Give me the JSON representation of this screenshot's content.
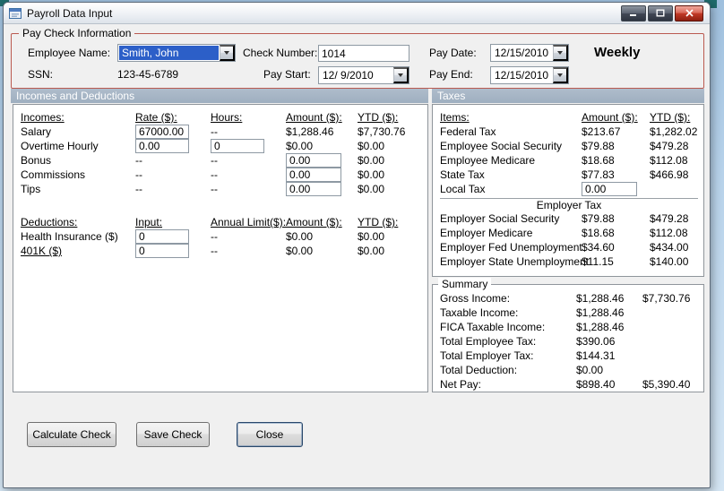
{
  "window": {
    "title": "Payroll Data Input"
  },
  "paycheck": {
    "group_title": "Pay Check Information",
    "employee_name": {
      "label": "Employee Name:",
      "value": "Smith, John"
    },
    "ssn": {
      "label": "SSN:",
      "value": "123-45-6789"
    },
    "check_number": {
      "label": "Check Number:",
      "value": "1014"
    },
    "pay_start": {
      "label": "Pay Start:",
      "value": "12/ 9/2010"
    },
    "pay_date": {
      "label": "Pay Date:",
      "value": "12/15/2010"
    },
    "pay_end": {
      "label": "Pay End:",
      "value": "12/15/2010"
    },
    "frequency": "Weekly"
  },
  "section_headers": {
    "left": "Incomes and Deductions",
    "right": "Taxes"
  },
  "incomes": {
    "headers": [
      "Incomes:",
      "Rate ($):",
      "Hours:",
      "Amount ($):",
      "YTD ($):"
    ],
    "rows": [
      {
        "label": "Salary",
        "rate": "67000.00",
        "hours": "--",
        "amount": "$1,288.46",
        "ytd": "$7,730.76"
      },
      {
        "label": "Overtime Hourly",
        "rate": "0.00",
        "hours": "0",
        "amount": "$0.00",
        "ytd": "$0.00"
      },
      {
        "label": "Bonus",
        "rate": "--",
        "hours": "--",
        "amount": "0.00",
        "ytd": "$0.00"
      },
      {
        "label": "Commissions",
        "rate": "--",
        "hours": "--",
        "amount": "0.00",
        "ytd": "$0.00"
      },
      {
        "label": "Tips",
        "rate": "--",
        "hours": "--",
        "amount": "0.00",
        "ytd": "$0.00"
      }
    ]
  },
  "deductions": {
    "headers": [
      "Deductions:",
      "Input:",
      "Annual Limit($):",
      "Amount ($):",
      "YTD ($):"
    ],
    "rows": [
      {
        "label": "Health Insurance  ($)",
        "input": "0",
        "limit": "--",
        "amount": "$0.00",
        "ytd": "$0.00"
      },
      {
        "label": "401K  ($)",
        "input": "0",
        "limit": "--",
        "amount": "$0.00",
        "ytd": "$0.00"
      }
    ]
  },
  "taxes": {
    "headers": [
      "Items:",
      "Amount ($):",
      "YTD ($):"
    ],
    "employee_rows": [
      {
        "label": "Federal Tax",
        "amount": "$213.67",
        "ytd": "$1,282.02"
      },
      {
        "label": "Employee Social Security",
        "amount": "$79.88",
        "ytd": "$479.28"
      },
      {
        "label": "Employee Medicare",
        "amount": "$18.68",
        "ytd": "$112.08"
      },
      {
        "label": "State Tax",
        "amount": "$77.83",
        "ytd": "$466.98"
      },
      {
        "label": "Local Tax",
        "amount": "0.00",
        "ytd": ""
      }
    ],
    "employer_divider": "Employer Tax",
    "employer_rows": [
      {
        "label": "Employer Social Security",
        "amount": "$79.88",
        "ytd": "$479.28"
      },
      {
        "label": "Employer Medicare",
        "amount": "$18.68",
        "ytd": "$112.08"
      },
      {
        "label": "Employer Fed Unemployment",
        "amount": "$34.60",
        "ytd": "$434.00"
      },
      {
        "label": "Employer State Unemployment",
        "amount": "$11.15",
        "ytd": "$140.00"
      }
    ]
  },
  "summary": {
    "group_title": "Summary",
    "rows": [
      {
        "label": "Gross Income:",
        "amount": "$1,288.46",
        "ytd": "$7,730.76"
      },
      {
        "label": "Taxable Income:",
        "amount": "$1,288.46",
        "ytd": ""
      },
      {
        "label": "FICA Taxable Income:",
        "amount": "$1,288.46",
        "ytd": ""
      },
      {
        "label": "Total Employee Tax:",
        "amount": "$390.06",
        "ytd": ""
      },
      {
        "label": "Total Employer Tax:",
        "amount": "$144.31",
        "ytd": ""
      },
      {
        "label": "Total Deduction:",
        "amount": "$0.00",
        "ytd": ""
      },
      {
        "label": "Net Pay:",
        "amount": "$898.40",
        "ytd": "$5,390.40"
      }
    ]
  },
  "buttons": {
    "calculate": "Calculate Check",
    "save": "Save Check",
    "close": "Close"
  }
}
